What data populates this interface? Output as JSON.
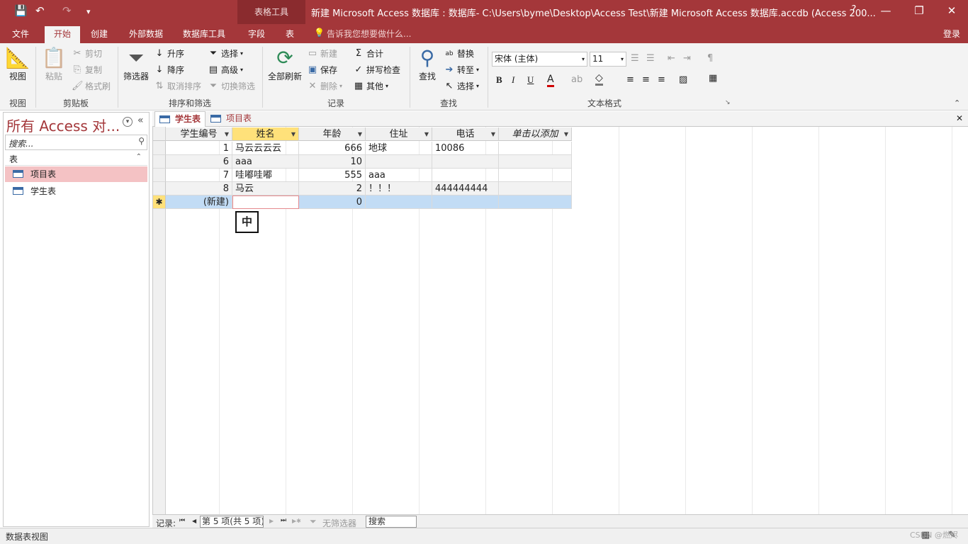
{
  "titlebar": {
    "context_tools": "表格工具",
    "window_title": "新建 Microsoft Access 数据库 : 数据库- C:\\Users\\byme\\Desktop\\Access Test\\新建 Microsoft Access 数据库.accdb (Access 200...",
    "help": "?",
    "restore": "❐",
    "minimize": "—",
    "close": "✕",
    "save_icon": "💾",
    "undo": "↶",
    "redo": "↷",
    "customize": "▾"
  },
  "ribbon_tabs": {
    "file": "文件",
    "home": "开始",
    "create": "创建",
    "external": "外部数据",
    "dbtools": "数据库工具",
    "fields": "字段",
    "table": "表",
    "tell_me": "告诉我您想要做什么...",
    "signin": "登录"
  },
  "ribbon": {
    "view": {
      "label": "视图",
      "group": "视图"
    },
    "clipboard": {
      "paste": "粘贴",
      "cut": "剪切",
      "copy": "复制",
      "format_painter": "格式刷",
      "group": "剪贴板"
    },
    "sort_filter": {
      "filter": "筛选器",
      "ascending": "升序",
      "descending": "降序",
      "clear_sort": "取消排序",
      "selection": "选择",
      "advanced": "高级",
      "toggle_filter": "切换筛选",
      "group": "排序和筛选"
    },
    "records": {
      "refresh_all": "全部刷新",
      "new": "新建",
      "save": "保存",
      "delete": "删除",
      "totals": "合计",
      "spelling": "拼写检查",
      "more": "其他",
      "group": "记录"
    },
    "find": {
      "find": "查找",
      "replace": "替换",
      "goto": "转至",
      "select": "选择",
      "group": "查找"
    },
    "text_format": {
      "font": "宋体 (主体)",
      "size": "11",
      "bold": "B",
      "italic": "I",
      "underline": "U",
      "group": "文本格式"
    }
  },
  "nav": {
    "title": "所有 Access 对...",
    "search_placeholder": "搜索...",
    "section": "表",
    "items": [
      "项目表",
      "学生表"
    ]
  },
  "doc_tabs": [
    "学生表",
    "项目表"
  ],
  "table": {
    "columns": [
      "学生编号",
      "姓名",
      "年龄",
      "住址",
      "电话",
      "单击以添加"
    ],
    "rows": [
      [
        "1",
        "马云云云云",
        "666",
        "地球",
        "10086"
      ],
      [
        "6",
        "aaa",
        "10",
        "",
        ""
      ],
      [
        "7",
        "哇嘟哇嘟",
        "555",
        "aaa",
        ""
      ],
      [
        "8",
        "马云",
        "2",
        "！！！",
        "444444444"
      ]
    ],
    "new_row": {
      "id": "(新建)",
      "age": "0",
      "marker": "✱"
    },
    "ime_indicator": "中"
  },
  "record_nav": {
    "label": "记录:",
    "first": "⏮",
    "prev": "◀",
    "position": "第 5 项(共 5 项)",
    "next": "▶",
    "last": "⏭",
    "new": "▶✱",
    "filter_status": "无筛选器",
    "search": "搜索"
  },
  "status": {
    "view_name": "数据表视图",
    "watermark": "CSDN @燃烬"
  }
}
